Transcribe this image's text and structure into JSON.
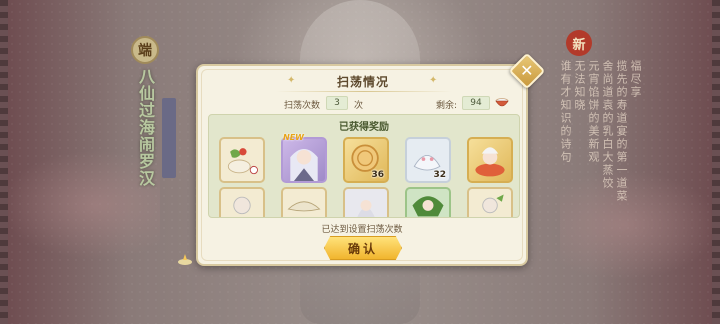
{
  "background": {
    "left_seal": "端",
    "left_title": "八仙过海闹罗汉",
    "left_tag": "",
    "right_seal": "新",
    "right_columns": [
      "福尽享",
      "揽先的寿道宴的第一道菜",
      "舍尚道袁的乳白大蒸饺",
      "元宵馅饼的美新观",
      "无法知晓",
      "谁有才知识的诗句"
    ]
  },
  "dialog": {
    "title": "扫荡情况",
    "close_label": "✕",
    "stats": {
      "count_label": "扫荡次数",
      "count_value": "3",
      "count_unit": "次",
      "remain_label": "剩余:",
      "remain_value": "94"
    },
    "rewards": {
      "title": "已获得奖励",
      "new_badge": "NEW",
      "items": [
        {
          "name": "dumpling-vegetable-icon",
          "qty": ""
        },
        {
          "name": "character-portrait-icon",
          "qty": ""
        },
        {
          "name": "mooncake-icon",
          "qty": "36"
        },
        {
          "name": "rice-dumpling-icon",
          "qty": "32"
        },
        {
          "name": "chef-character-icon",
          "qty": ""
        },
        {
          "name": "character-small-icon",
          "qty": ""
        },
        {
          "name": "dumpling-icon",
          "qty": ""
        },
        {
          "name": "silver-hair-character-icon",
          "qty": ""
        },
        {
          "name": "green-character-icon",
          "qty": ""
        },
        {
          "name": "chef-small-icon",
          "qty": ""
        }
      ]
    },
    "footer_note": "已达到设置扫荡次数",
    "confirm_label": "确认"
  },
  "colors": {
    "dialog_bg": "#f6f2e3",
    "panel_bg": "#e2e6cc",
    "button_gold": "#f1b52e",
    "close_gold": "#c9993c"
  }
}
